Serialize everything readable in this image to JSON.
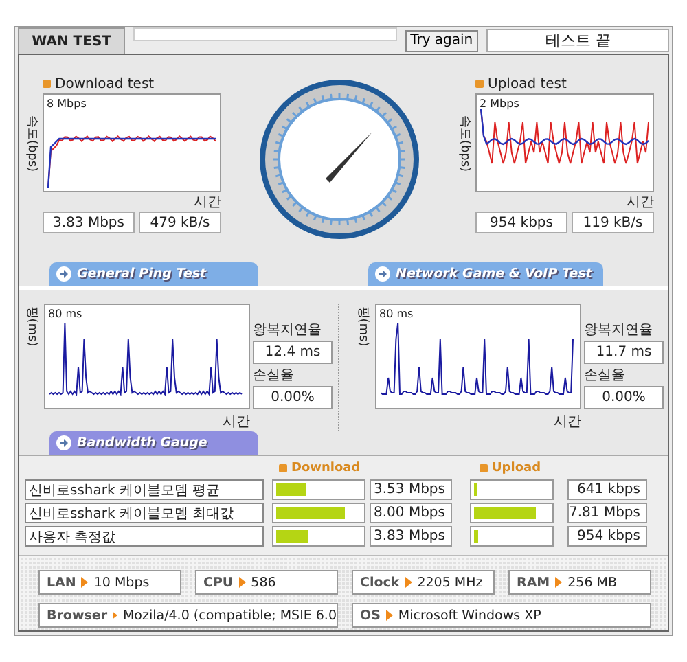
{
  "header": {
    "tab": "WAN TEST",
    "button": "Try again",
    "status": "테스트 끝"
  },
  "speed_tests": [
    {
      "kind": "download",
      "title": "Download test",
      "y_axis": "속도(bps)",
      "max_label": "8 Mbps",
      "x_axis": "시간",
      "readings": [
        "3.83 Mbps",
        "479 kB/s"
      ]
    },
    {
      "kind": "upload",
      "title": "Upload test",
      "y_axis": "속도(bps)",
      "max_label": "2 Mbps",
      "x_axis": "시간",
      "readings": [
        "954 kbps",
        "119 kB/s"
      ]
    }
  ],
  "section_tabs": [
    {
      "label": "General Ping Test",
      "color": "#7eaee6"
    },
    {
      "label": "Network Game & VoIP Test",
      "color": "#7eaee6"
    }
  ],
  "ping_tests": [
    {
      "y_axis": "핑(ms)",
      "max_label": "80 ms",
      "x_axis": "시간",
      "latency_label": "왕복지연율",
      "latency": "12.4 ms",
      "loss_label": "손실율",
      "loss": "0.00%"
    },
    {
      "y_axis": "핑(ms)",
      "max_label": "80 ms",
      "x_axis": "시간",
      "latency_label": "왕복지연율",
      "latency": "11.7 ms",
      "loss_label": "손실율",
      "loss": "0.00%"
    }
  ],
  "gauge_tab": {
    "label": "Bandwidth Gauge",
    "color": "#8f8fe0"
  },
  "bandwidth": {
    "columns": [
      "Download",
      "Upload"
    ],
    "rows": [
      {
        "name": "신비로sshark 케이블모뎀 평균",
        "download": {
          "value": "3.53 Mbps",
          "level": 0.35
        },
        "upload": {
          "value": "641 kbps",
          "level": 0.03
        }
      },
      {
        "name": "신비로sshark 케이블모뎀 최대값",
        "download": {
          "value": "8.00 Mbps",
          "level": 0.8
        },
        "upload": {
          "value": "7.81 Mbps",
          "level": 0.82
        }
      },
      {
        "name": "사용자 측정값",
        "download": {
          "value": "3.83 Mbps",
          "level": 0.37
        },
        "upload": {
          "value": "954 kbps",
          "level": 0.06
        }
      }
    ]
  },
  "system": [
    [
      {
        "label": "LAN",
        "value": "10 Mbps"
      },
      {
        "label": "CPU",
        "value": "586"
      },
      {
        "label": "Clock",
        "value": "2205 MHz"
      },
      {
        "label": "RAM",
        "value": "256 MB"
      }
    ],
    [
      {
        "label": "Browser",
        "value": "Mozila/4.0 (compatible; MSIE 6.0"
      },
      {
        "label": "OS",
        "value": "Microsoft Windows XP"
      }
    ]
  ]
}
